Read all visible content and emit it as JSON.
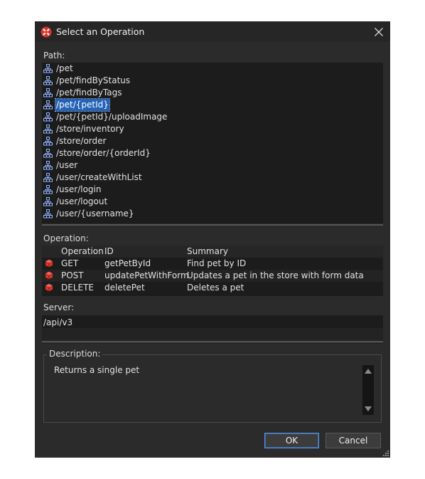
{
  "dialog": {
    "title": "Select an Operation",
    "path_label": "Path:",
    "operation_label": "Operation:",
    "server_label": "Server:",
    "description_label": "Description:"
  },
  "paths": [
    {
      "label": "/pet",
      "selected": false
    },
    {
      "label": "/pet/findByStatus",
      "selected": false
    },
    {
      "label": "/pet/findByTags",
      "selected": false
    },
    {
      "label": "/pet/{petId}",
      "selected": true
    },
    {
      "label": "/pet/{petId}/uploadImage",
      "selected": false
    },
    {
      "label": "/store/inventory",
      "selected": false
    },
    {
      "label": "/store/order",
      "selected": false
    },
    {
      "label": "/store/order/{orderId}",
      "selected": false
    },
    {
      "label": "/user",
      "selected": false
    },
    {
      "label": "/user/createWithList",
      "selected": false
    },
    {
      "label": "/user/login",
      "selected": false
    },
    {
      "label": "/user/logout",
      "selected": false
    },
    {
      "label": "/user/{username}",
      "selected": false
    }
  ],
  "operations": {
    "headers": {
      "operation": "Operation",
      "id": "ID",
      "summary": "Summary"
    },
    "rows": [
      {
        "method": "GET",
        "id": "getPetById",
        "summary": "Find pet by ID"
      },
      {
        "method": "POST",
        "id": "updatePetWithForm",
        "summary": "Updates a pet in the store with form data"
      },
      {
        "method": "DELETE",
        "id": "deletePet",
        "summary": "Deletes a pet"
      }
    ]
  },
  "server": {
    "value": "/api/v3",
    "input_value": ""
  },
  "description": {
    "text": "Returns a single pet"
  },
  "buttons": {
    "ok": "OK",
    "cancel": "Cancel"
  },
  "icons": {
    "app": "app-logo-icon",
    "close": "close-icon",
    "path": "path-tree-icon",
    "method": "operation-cube-icon"
  },
  "colors": {
    "selection": "#2563b8",
    "dialog_bg": "#2b2b2b",
    "list_bg": "#1c1c1c",
    "method_icon": "#d9342b",
    "ok_border": "#5b8fd0"
  }
}
